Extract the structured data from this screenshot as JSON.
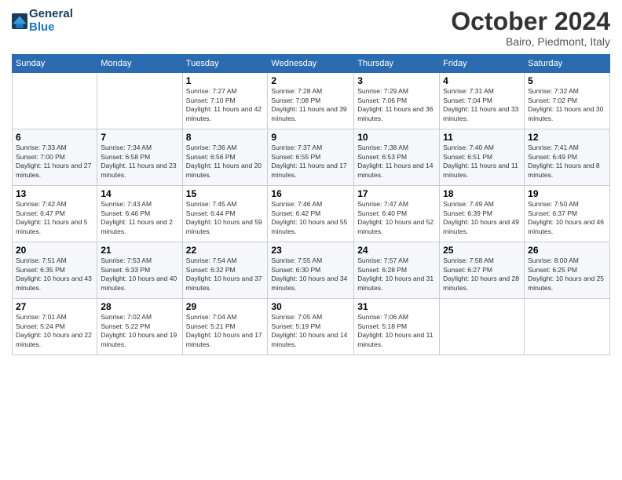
{
  "header": {
    "logo_general": "General",
    "logo_blue": "Blue",
    "month_title": "October 2024",
    "location": "Bairo, Piedmont, Italy"
  },
  "days_of_week": [
    "Sunday",
    "Monday",
    "Tuesday",
    "Wednesday",
    "Thursday",
    "Friday",
    "Saturday"
  ],
  "weeks": [
    [
      {
        "day": "",
        "sunrise": "",
        "sunset": "",
        "daylight": ""
      },
      {
        "day": "",
        "sunrise": "",
        "sunset": "",
        "daylight": ""
      },
      {
        "day": "1",
        "sunrise": "Sunrise: 7:27 AM",
        "sunset": "Sunset: 7:10 PM",
        "daylight": "Daylight: 11 hours and 42 minutes."
      },
      {
        "day": "2",
        "sunrise": "Sunrise: 7:28 AM",
        "sunset": "Sunset: 7:08 PM",
        "daylight": "Daylight: 11 hours and 39 minutes."
      },
      {
        "day": "3",
        "sunrise": "Sunrise: 7:29 AM",
        "sunset": "Sunset: 7:06 PM",
        "daylight": "Daylight: 11 hours and 36 minutes."
      },
      {
        "day": "4",
        "sunrise": "Sunrise: 7:31 AM",
        "sunset": "Sunset: 7:04 PM",
        "daylight": "Daylight: 11 hours and 33 minutes."
      },
      {
        "day": "5",
        "sunrise": "Sunrise: 7:32 AM",
        "sunset": "Sunset: 7:02 PM",
        "daylight": "Daylight: 11 hours and 30 minutes."
      }
    ],
    [
      {
        "day": "6",
        "sunrise": "Sunrise: 7:33 AM",
        "sunset": "Sunset: 7:00 PM",
        "daylight": "Daylight: 11 hours and 27 minutes."
      },
      {
        "day": "7",
        "sunrise": "Sunrise: 7:34 AM",
        "sunset": "Sunset: 6:58 PM",
        "daylight": "Daylight: 11 hours and 23 minutes."
      },
      {
        "day": "8",
        "sunrise": "Sunrise: 7:36 AM",
        "sunset": "Sunset: 6:56 PM",
        "daylight": "Daylight: 11 hours and 20 minutes."
      },
      {
        "day": "9",
        "sunrise": "Sunrise: 7:37 AM",
        "sunset": "Sunset: 6:55 PM",
        "daylight": "Daylight: 11 hours and 17 minutes."
      },
      {
        "day": "10",
        "sunrise": "Sunrise: 7:38 AM",
        "sunset": "Sunset: 6:53 PM",
        "daylight": "Daylight: 11 hours and 14 minutes."
      },
      {
        "day": "11",
        "sunrise": "Sunrise: 7:40 AM",
        "sunset": "Sunset: 6:51 PM",
        "daylight": "Daylight: 11 hours and 11 minutes."
      },
      {
        "day": "12",
        "sunrise": "Sunrise: 7:41 AM",
        "sunset": "Sunset: 6:49 PM",
        "daylight": "Daylight: 11 hours and 8 minutes."
      }
    ],
    [
      {
        "day": "13",
        "sunrise": "Sunrise: 7:42 AM",
        "sunset": "Sunset: 6:47 PM",
        "daylight": "Daylight: 11 hours and 5 minutes."
      },
      {
        "day": "14",
        "sunrise": "Sunrise: 7:43 AM",
        "sunset": "Sunset: 6:46 PM",
        "daylight": "Daylight: 11 hours and 2 minutes."
      },
      {
        "day": "15",
        "sunrise": "Sunrise: 7:45 AM",
        "sunset": "Sunset: 6:44 PM",
        "daylight": "Daylight: 10 hours and 59 minutes."
      },
      {
        "day": "16",
        "sunrise": "Sunrise: 7:46 AM",
        "sunset": "Sunset: 6:42 PM",
        "daylight": "Daylight: 10 hours and 55 minutes."
      },
      {
        "day": "17",
        "sunrise": "Sunrise: 7:47 AM",
        "sunset": "Sunset: 6:40 PM",
        "daylight": "Daylight: 10 hours and 52 minutes."
      },
      {
        "day": "18",
        "sunrise": "Sunrise: 7:49 AM",
        "sunset": "Sunset: 6:39 PM",
        "daylight": "Daylight: 10 hours and 49 minutes."
      },
      {
        "day": "19",
        "sunrise": "Sunrise: 7:50 AM",
        "sunset": "Sunset: 6:37 PM",
        "daylight": "Daylight: 10 hours and 46 minutes."
      }
    ],
    [
      {
        "day": "20",
        "sunrise": "Sunrise: 7:51 AM",
        "sunset": "Sunset: 6:35 PM",
        "daylight": "Daylight: 10 hours and 43 minutes."
      },
      {
        "day": "21",
        "sunrise": "Sunrise: 7:53 AM",
        "sunset": "Sunset: 6:33 PM",
        "daylight": "Daylight: 10 hours and 40 minutes."
      },
      {
        "day": "22",
        "sunrise": "Sunrise: 7:54 AM",
        "sunset": "Sunset: 6:32 PM",
        "daylight": "Daylight: 10 hours and 37 minutes."
      },
      {
        "day": "23",
        "sunrise": "Sunrise: 7:55 AM",
        "sunset": "Sunset: 6:30 PM",
        "daylight": "Daylight: 10 hours and 34 minutes."
      },
      {
        "day": "24",
        "sunrise": "Sunrise: 7:57 AM",
        "sunset": "Sunset: 6:28 PM",
        "daylight": "Daylight: 10 hours and 31 minutes."
      },
      {
        "day": "25",
        "sunrise": "Sunrise: 7:58 AM",
        "sunset": "Sunset: 6:27 PM",
        "daylight": "Daylight: 10 hours and 28 minutes."
      },
      {
        "day": "26",
        "sunrise": "Sunrise: 8:00 AM",
        "sunset": "Sunset: 6:25 PM",
        "daylight": "Daylight: 10 hours and 25 minutes."
      }
    ],
    [
      {
        "day": "27",
        "sunrise": "Sunrise: 7:01 AM",
        "sunset": "Sunset: 5:24 PM",
        "daylight": "Daylight: 10 hours and 22 minutes."
      },
      {
        "day": "28",
        "sunrise": "Sunrise: 7:02 AM",
        "sunset": "Sunset: 5:22 PM",
        "daylight": "Daylight: 10 hours and 19 minutes."
      },
      {
        "day": "29",
        "sunrise": "Sunrise: 7:04 AM",
        "sunset": "Sunset: 5:21 PM",
        "daylight": "Daylight: 10 hours and 17 minutes."
      },
      {
        "day": "30",
        "sunrise": "Sunrise: 7:05 AM",
        "sunset": "Sunset: 5:19 PM",
        "daylight": "Daylight: 10 hours and 14 minutes."
      },
      {
        "day": "31",
        "sunrise": "Sunrise: 7:06 AM",
        "sunset": "Sunset: 5:18 PM",
        "daylight": "Daylight: 10 hours and 11 minutes."
      },
      {
        "day": "",
        "sunrise": "",
        "sunset": "",
        "daylight": ""
      },
      {
        "day": "",
        "sunrise": "",
        "sunset": "",
        "daylight": ""
      }
    ]
  ]
}
